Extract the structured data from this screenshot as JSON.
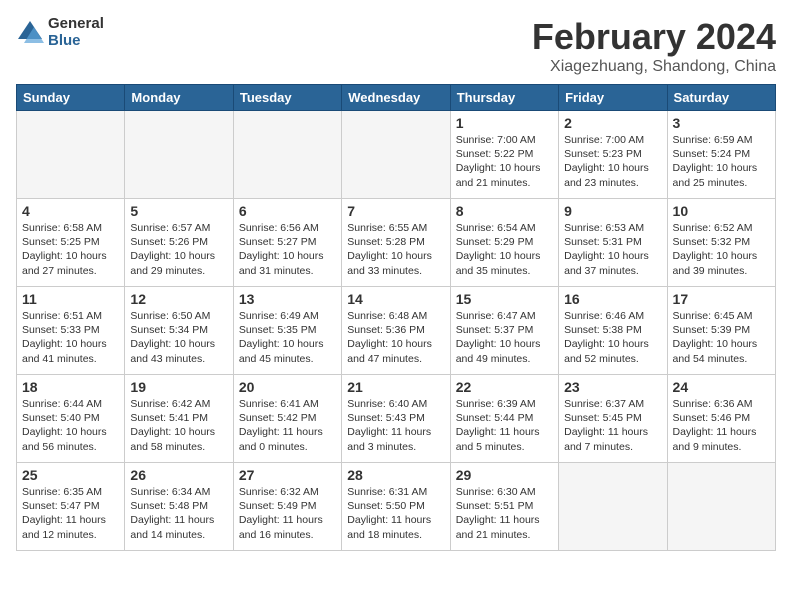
{
  "header": {
    "logo_general": "General",
    "logo_blue": "Blue",
    "month_title": "February 2024",
    "location": "Xiagezhuang, Shandong, China"
  },
  "days_of_week": [
    "Sunday",
    "Monday",
    "Tuesday",
    "Wednesday",
    "Thursday",
    "Friday",
    "Saturday"
  ],
  "weeks": [
    [
      {
        "day": "",
        "info": ""
      },
      {
        "day": "",
        "info": ""
      },
      {
        "day": "",
        "info": ""
      },
      {
        "day": "",
        "info": ""
      },
      {
        "day": "1",
        "info": "Sunrise: 7:00 AM\nSunset: 5:22 PM\nDaylight: 10 hours\nand 21 minutes."
      },
      {
        "day": "2",
        "info": "Sunrise: 7:00 AM\nSunset: 5:23 PM\nDaylight: 10 hours\nand 23 minutes."
      },
      {
        "day": "3",
        "info": "Sunrise: 6:59 AM\nSunset: 5:24 PM\nDaylight: 10 hours\nand 25 minutes."
      }
    ],
    [
      {
        "day": "4",
        "info": "Sunrise: 6:58 AM\nSunset: 5:25 PM\nDaylight: 10 hours\nand 27 minutes."
      },
      {
        "day": "5",
        "info": "Sunrise: 6:57 AM\nSunset: 5:26 PM\nDaylight: 10 hours\nand 29 minutes."
      },
      {
        "day": "6",
        "info": "Sunrise: 6:56 AM\nSunset: 5:27 PM\nDaylight: 10 hours\nand 31 minutes."
      },
      {
        "day": "7",
        "info": "Sunrise: 6:55 AM\nSunset: 5:28 PM\nDaylight: 10 hours\nand 33 minutes."
      },
      {
        "day": "8",
        "info": "Sunrise: 6:54 AM\nSunset: 5:29 PM\nDaylight: 10 hours\nand 35 minutes."
      },
      {
        "day": "9",
        "info": "Sunrise: 6:53 AM\nSunset: 5:31 PM\nDaylight: 10 hours\nand 37 minutes."
      },
      {
        "day": "10",
        "info": "Sunrise: 6:52 AM\nSunset: 5:32 PM\nDaylight: 10 hours\nand 39 minutes."
      }
    ],
    [
      {
        "day": "11",
        "info": "Sunrise: 6:51 AM\nSunset: 5:33 PM\nDaylight: 10 hours\nand 41 minutes."
      },
      {
        "day": "12",
        "info": "Sunrise: 6:50 AM\nSunset: 5:34 PM\nDaylight: 10 hours\nand 43 minutes."
      },
      {
        "day": "13",
        "info": "Sunrise: 6:49 AM\nSunset: 5:35 PM\nDaylight: 10 hours\nand 45 minutes."
      },
      {
        "day": "14",
        "info": "Sunrise: 6:48 AM\nSunset: 5:36 PM\nDaylight: 10 hours\nand 47 minutes."
      },
      {
        "day": "15",
        "info": "Sunrise: 6:47 AM\nSunset: 5:37 PM\nDaylight: 10 hours\nand 49 minutes."
      },
      {
        "day": "16",
        "info": "Sunrise: 6:46 AM\nSunset: 5:38 PM\nDaylight: 10 hours\nand 52 minutes."
      },
      {
        "day": "17",
        "info": "Sunrise: 6:45 AM\nSunset: 5:39 PM\nDaylight: 10 hours\nand 54 minutes."
      }
    ],
    [
      {
        "day": "18",
        "info": "Sunrise: 6:44 AM\nSunset: 5:40 PM\nDaylight: 10 hours\nand 56 minutes."
      },
      {
        "day": "19",
        "info": "Sunrise: 6:42 AM\nSunset: 5:41 PM\nDaylight: 10 hours\nand 58 minutes."
      },
      {
        "day": "20",
        "info": "Sunrise: 6:41 AM\nSunset: 5:42 PM\nDaylight: 11 hours\nand 0 minutes."
      },
      {
        "day": "21",
        "info": "Sunrise: 6:40 AM\nSunset: 5:43 PM\nDaylight: 11 hours\nand 3 minutes."
      },
      {
        "day": "22",
        "info": "Sunrise: 6:39 AM\nSunset: 5:44 PM\nDaylight: 11 hours\nand 5 minutes."
      },
      {
        "day": "23",
        "info": "Sunrise: 6:37 AM\nSunset: 5:45 PM\nDaylight: 11 hours\nand 7 minutes."
      },
      {
        "day": "24",
        "info": "Sunrise: 6:36 AM\nSunset: 5:46 PM\nDaylight: 11 hours\nand 9 minutes."
      }
    ],
    [
      {
        "day": "25",
        "info": "Sunrise: 6:35 AM\nSunset: 5:47 PM\nDaylight: 11 hours\nand 12 minutes."
      },
      {
        "day": "26",
        "info": "Sunrise: 6:34 AM\nSunset: 5:48 PM\nDaylight: 11 hours\nand 14 minutes."
      },
      {
        "day": "27",
        "info": "Sunrise: 6:32 AM\nSunset: 5:49 PM\nDaylight: 11 hours\nand 16 minutes."
      },
      {
        "day": "28",
        "info": "Sunrise: 6:31 AM\nSunset: 5:50 PM\nDaylight: 11 hours\nand 18 minutes."
      },
      {
        "day": "29",
        "info": "Sunrise: 6:30 AM\nSunset: 5:51 PM\nDaylight: 11 hours\nand 21 minutes."
      },
      {
        "day": "",
        "info": ""
      },
      {
        "day": "",
        "info": ""
      }
    ]
  ]
}
